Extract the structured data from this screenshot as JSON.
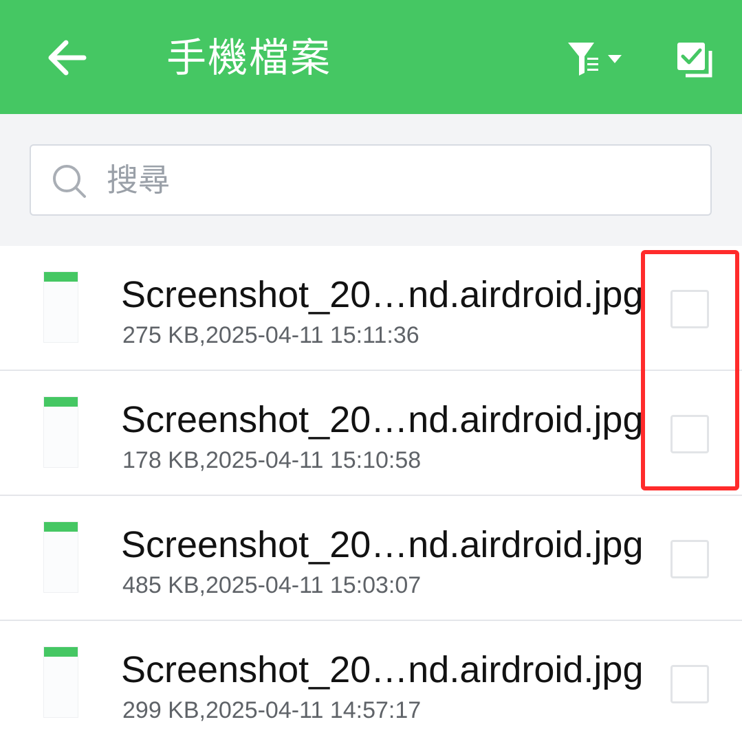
{
  "header": {
    "title": "手機檔案",
    "back_icon": "arrow-left-icon",
    "filter_icon": "filter-list-icon",
    "select_all_icon": "select-all-checkbox-icon",
    "background_color": "#45c763"
  },
  "search": {
    "placeholder": "搜尋",
    "value": ""
  },
  "files": [
    {
      "name": "Screenshot_20…nd.airdroid.jpg",
      "meta": "275 KB,2025-04-11 15:11:36",
      "checked": false
    },
    {
      "name": "Screenshot_20…nd.airdroid.jpg",
      "meta": "178 KB,2025-04-11 15:10:58",
      "checked": false
    },
    {
      "name": "Screenshot_20…nd.airdroid.jpg",
      "meta": "485 KB,2025-04-11 15:03:07",
      "checked": false
    },
    {
      "name": "Screenshot_20…nd.airdroid.jpg",
      "meta": "299 KB,2025-04-11 14:57:17",
      "checked": false
    }
  ],
  "annotation": {
    "color": "#ff2b2b"
  }
}
